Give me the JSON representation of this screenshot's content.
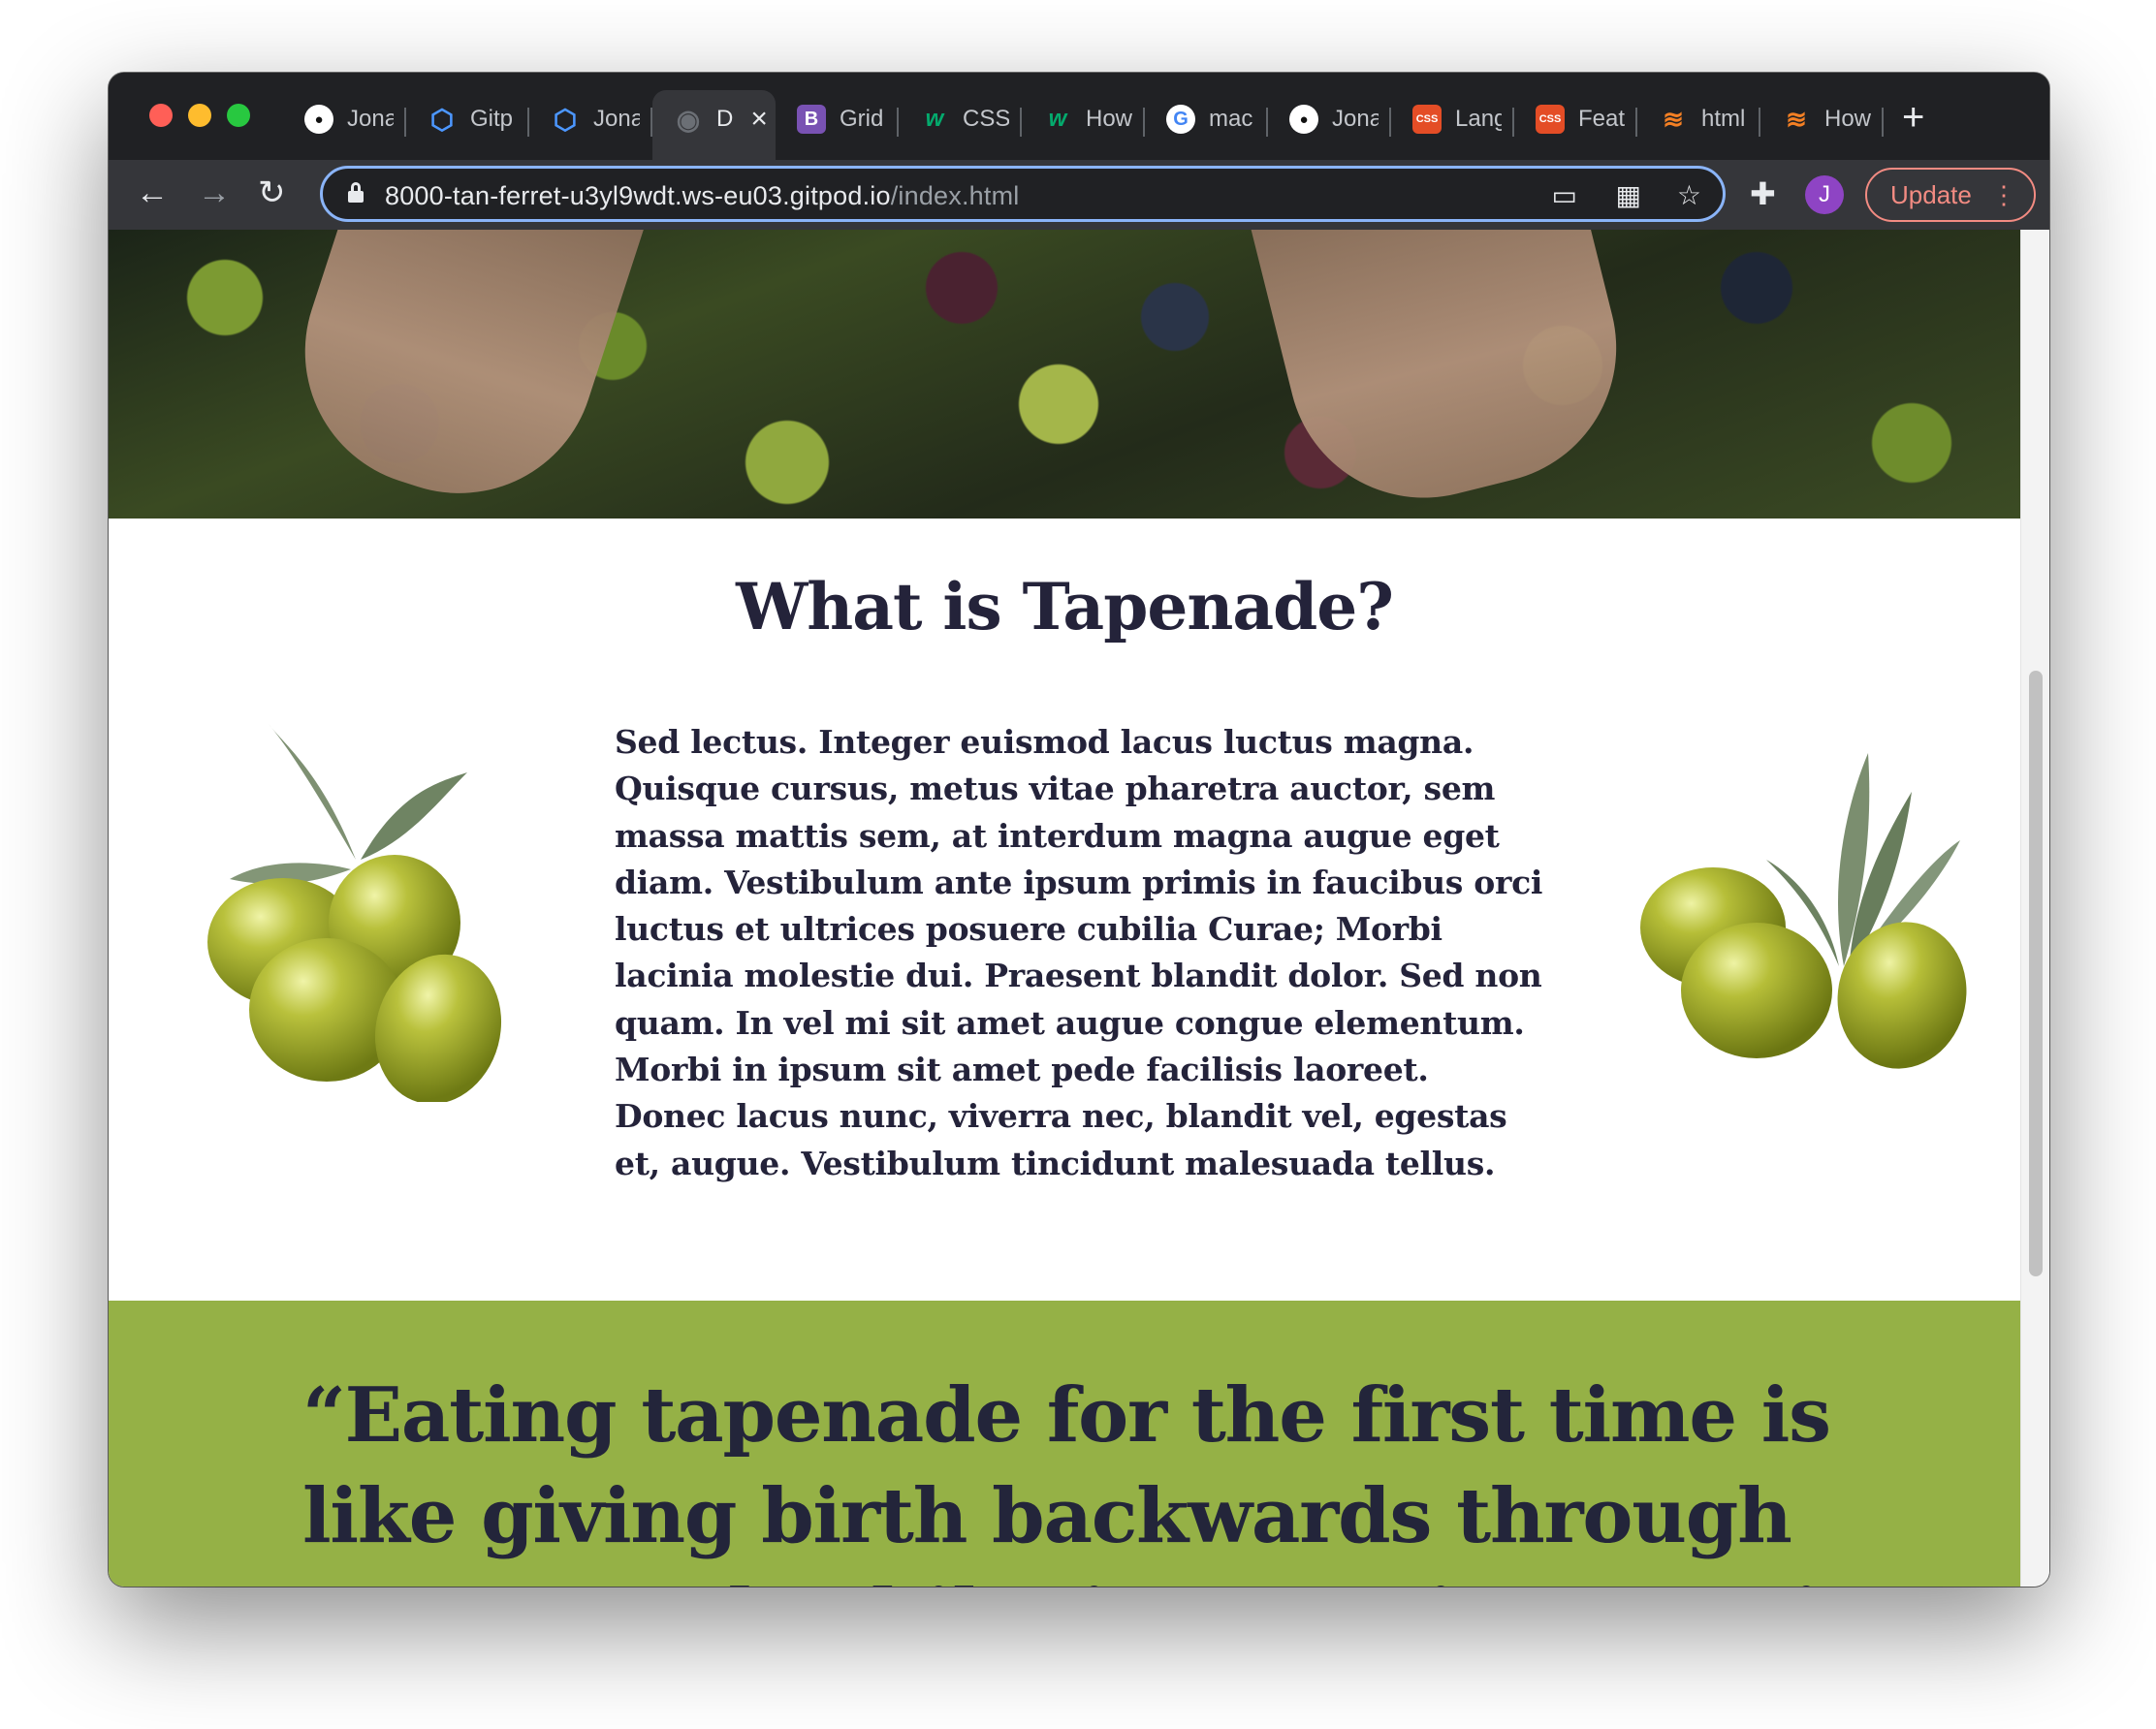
{
  "browser": {
    "tabs": [
      {
        "label": "Jona",
        "icon": "github-icon"
      },
      {
        "label": "Gitp",
        "icon": "gitpod-icon"
      },
      {
        "label": "Jona",
        "icon": "gitpod-icon"
      },
      {
        "label": "D",
        "icon": "globe-icon",
        "active": true
      },
      {
        "label": "Grid",
        "icon": "bootstrap-icon"
      },
      {
        "label": "CSS",
        "icon": "w3schools-icon"
      },
      {
        "label": "How",
        "icon": "w3schools-icon"
      },
      {
        "label": "mac",
        "icon": "google-icon"
      },
      {
        "label": "Jona",
        "icon": "github-icon"
      },
      {
        "label": "Lang",
        "icon": "css-icon"
      },
      {
        "label": "Feat",
        "icon": "css-icon"
      },
      {
        "label": "html",
        "icon": "stackoverflow-icon"
      },
      {
        "label": "How",
        "icon": "stackoverflow-icon"
      }
    ],
    "url_host": "8000-tan-ferret-u3yl9wdt.ws-eu03.gitpod.io",
    "url_path": "/index.html",
    "profile_initial": "J",
    "update_label": "Update",
    "colors": {
      "update_accent": "#f28b82",
      "omnibox_focus": "#8ab4f8"
    }
  },
  "page": {
    "heading": "What is Tapenade?",
    "body": "Sed lectus. Integer euismod lacus luctus magna. Quisque cursus, metus vitae pharetra auctor, sem massa mattis sem, at interdum magna augue eget diam. Vestibulum ante ipsum primis in faucibus orci luctus et ultrices posuere cubilia Curae; Morbi lacinia molestie dui. Praesent blandit dolor. Sed non quam. In vel mi sit amet augue congue elementum. Morbi in ipsum sit amet pede facilisis laoreet. Donec lacus nunc, viverra nec, blandit vel, egestas et, augue. Vestibulum tincidunt malesuada tellus.",
    "quote": "“Eating tapenade for the first time is like giving birth backwards through your mouth whilst in a semi-orgasmic state of oxygen",
    "colors": {
      "quote_band": "#95b146",
      "text": "#24233a"
    }
  }
}
